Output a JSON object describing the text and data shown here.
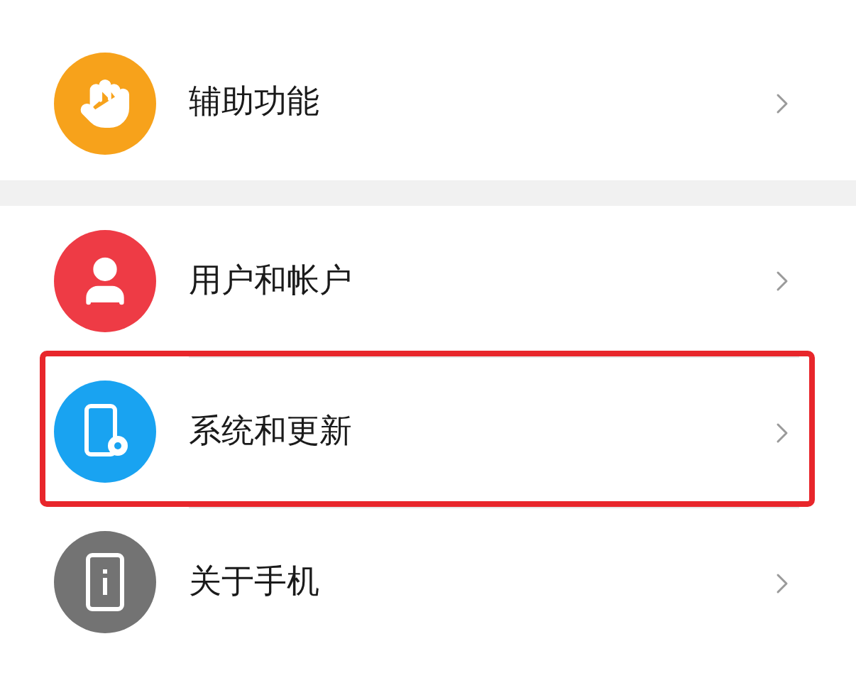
{
  "sections": [
    {
      "items": [
        {
          "label": "辅助功能",
          "kind": "hand",
          "color": "#f7a21b",
          "highlighted": false
        }
      ]
    },
    {
      "items": [
        {
          "label": "用户和帐户",
          "kind": "user",
          "color": "#ee3b45",
          "highlighted": false
        },
        {
          "label": "系统和更新",
          "kind": "system",
          "color": "#19a3f1",
          "highlighted": true
        },
        {
          "label": "关于手机",
          "kind": "about",
          "color": "#737373",
          "highlighted": false
        }
      ]
    }
  ]
}
